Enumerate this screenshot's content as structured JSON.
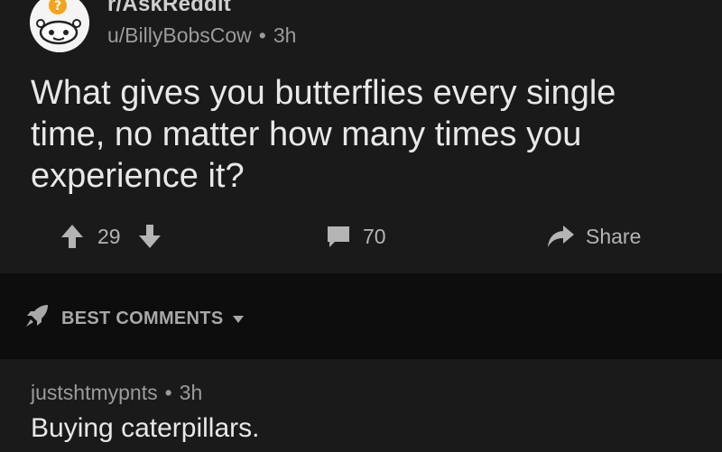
{
  "post": {
    "subreddit": "r/AskReddit",
    "author": "u/BillyBobsCow",
    "age": "3h",
    "separator": "•",
    "title": "What gives you butterflies every single time, no matter how many times you experience it?",
    "votes": "29",
    "comment_count": "70",
    "share_label": "Share"
  },
  "sort": {
    "label": "BEST COMMENTS"
  },
  "comments": [
    {
      "author": "justshtmypnts",
      "age": "3h",
      "separator": "•",
      "body": "Buying caterpillars."
    }
  ],
  "icons": {
    "avatar": "reddit-alien-avatar-icon",
    "upvote": "arrow-up-icon",
    "downvote": "arrow-down-icon",
    "comments": "comment-bubble-icon",
    "share": "share-arrow-icon",
    "sort": "rocket-icon",
    "dropdown": "caret-down-icon"
  },
  "colors": {
    "background": "#1a1a1b",
    "sortbar_background": "#0d0d0e",
    "text_primary": "#e8e8e8",
    "text_secondary": "#9b9b9b",
    "icon": "#b4b4b4",
    "avatar_accent": "#f7a21b"
  }
}
